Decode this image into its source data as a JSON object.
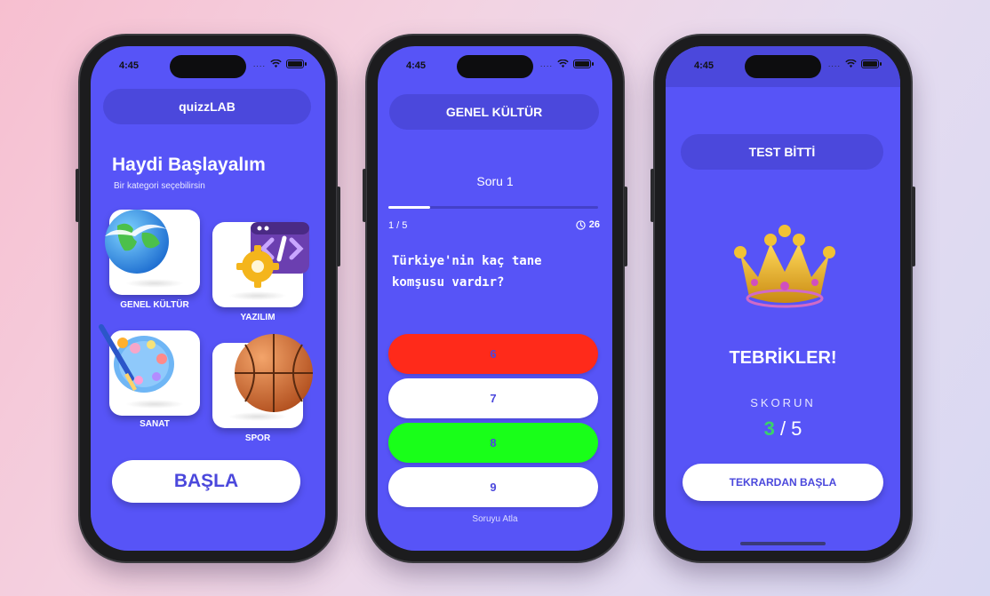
{
  "status": {
    "time": "4:45",
    "dots": "...."
  },
  "screens": {
    "home": {
      "app_title": "quizzLAB",
      "heading": "Haydi Başlayalım",
      "subheading": "Bir kategori seçebilirsin",
      "categories": [
        {
          "label": "GENEL KÜLTÜR",
          "icon": "globe-icon"
        },
        {
          "label": "YAZILIM",
          "icon": "code-gear-icon"
        },
        {
          "label": "SANAT",
          "icon": "palette-icon"
        },
        {
          "label": "SPOR",
          "icon": "basketball-icon"
        }
      ],
      "start_label": "BAŞLA"
    },
    "quiz": {
      "category_title": "GENEL KÜLTÜR",
      "question_number": "Soru 1",
      "progress_text": "1 / 5",
      "progress_fraction": 0.2,
      "timer": "26",
      "question": "Türkiye'nin kaç tane komşusu vardır?",
      "answers": [
        {
          "label": "6",
          "state": "wrong",
          "color": "#ff2a1a"
        },
        {
          "label": "7",
          "state": "default",
          "color": "#ffffff"
        },
        {
          "label": "8",
          "state": "correct",
          "color": "#19ff19"
        },
        {
          "label": "9",
          "state": "default",
          "color": "#ffffff"
        }
      ],
      "skip_label": "Soruyu Atla"
    },
    "result": {
      "header": "TEST BİTTİ",
      "congrats": "TEBRİKLER!",
      "score_label": "SKORUN",
      "score_correct": "3",
      "score_separator": " / ",
      "score_total": "5",
      "restart_label": "TEKRARDAN BAŞLA",
      "icon": "crown-icon"
    }
  },
  "colors": {
    "primary": "#5754f7",
    "header_pill": "#4b48dc",
    "wrong": "#ff2a1a",
    "correct": "#19ff19",
    "score_good": "#3ad26b"
  }
}
